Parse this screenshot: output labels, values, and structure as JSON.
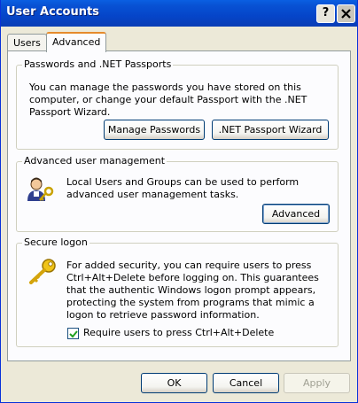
{
  "window": {
    "title": "User Accounts",
    "help_label": "?",
    "close_label": "X"
  },
  "tabs": [
    {
      "label": "Users",
      "active": false
    },
    {
      "label": "Advanced",
      "active": true
    }
  ],
  "passwords": {
    "title": "Passwords and .NET Passports",
    "text": "You can manage the passwords you have stored on this computer, or change your default Passport with the .NET Passport Wizard.",
    "manage_button": "Manage Passwords",
    "wizard_button": ".NET Passport Wizard"
  },
  "advanced": {
    "title": "Advanced user management",
    "text": "Local Users and Groups can be used to perform advanced user management tasks.",
    "advanced_button": "Advanced",
    "icon": "users-key-icon"
  },
  "secure_logon": {
    "title": "Secure logon",
    "text": "For added security, you can require users to press Ctrl+Alt+Delete before logging on. This guarantees that the authentic Windows logon prompt appears, protecting the system from programs that mimic a logon to retrieve password information.",
    "checkbox_label": "Require users to press Ctrl+Alt+Delete",
    "checked": true,
    "icon": "key-icon"
  },
  "footer": {
    "ok": "OK",
    "cancel": "Cancel",
    "apply": "Apply"
  },
  "colors": {
    "titlebar": "#0545c9",
    "background": "#ece9d8",
    "panel": "#fcfcfe",
    "tab_highlight": "#e68b2c"
  }
}
